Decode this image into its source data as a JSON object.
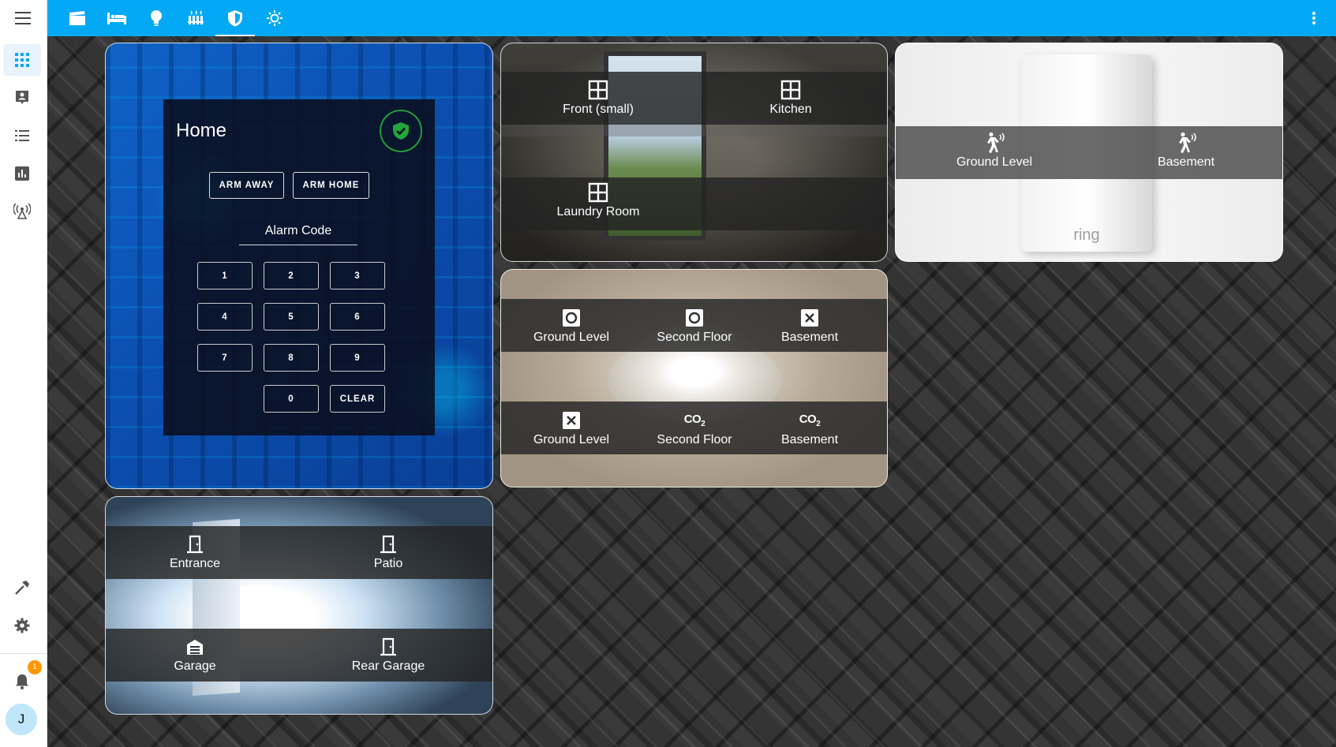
{
  "app": {
    "accent": "#03a9f4",
    "view_tabs": [
      {
        "icon": "movie-clapper-icon",
        "active": false
      },
      {
        "icon": "bed-icon",
        "active": false
      },
      {
        "icon": "lightbulb-icon",
        "active": false
      },
      {
        "icon": "radiator-icon",
        "active": false
      },
      {
        "icon": "shield-icon",
        "active": true
      },
      {
        "icon": "sun-icon",
        "active": false
      }
    ]
  },
  "sidebar": {
    "items": [
      {
        "icon": "grid-dashboard-icon",
        "active": true
      },
      {
        "icon": "account-box-icon",
        "active": false
      },
      {
        "icon": "list-icon",
        "active": false
      },
      {
        "icon": "chart-icon",
        "active": false
      },
      {
        "icon": "antenna-icon",
        "active": false
      }
    ],
    "bottom_items": [
      {
        "icon": "hammer-icon"
      },
      {
        "icon": "gear-icon"
      }
    ],
    "notification_count": "1",
    "user_initial": "J"
  },
  "alarm": {
    "state": "Home",
    "arm_away": "ARM AWAY",
    "arm_home": "ARM HOME",
    "code_label": "Alarm Code",
    "keys": [
      "1",
      "2",
      "3",
      "4",
      "5",
      "6",
      "7",
      "8",
      "9",
      "0",
      "CLEAR"
    ]
  },
  "windows": {
    "sensors": [
      {
        "label": "Front (small)",
        "icon": "window-icon"
      },
      {
        "label": "Kitchen",
        "icon": "window-icon"
      },
      {
        "label": "Laundry Room",
        "icon": "window-icon"
      }
    ]
  },
  "motion": {
    "brand": "ring",
    "sensors": [
      {
        "label": "Ground Level",
        "icon": "motion-walk-icon"
      },
      {
        "label": "Basement",
        "icon": "motion-walk-icon"
      }
    ]
  },
  "smoke": {
    "smoke_sensors": [
      {
        "label": "Ground Level",
        "icon": "smoke-ok-icon"
      },
      {
        "label": "Second Floor",
        "icon": "smoke-ok-icon"
      },
      {
        "label": "Basement",
        "icon": "smoke-alert-icon"
      }
    ],
    "co2_sensors": [
      {
        "label": "Ground Level",
        "icon": "co-alert-icon"
      },
      {
        "label": "Second Floor",
        "icon": "co2-icon",
        "text": "CO2"
      },
      {
        "label": "Basement",
        "icon": "co2-icon",
        "text": "CO2"
      }
    ]
  },
  "doors": {
    "sensors": [
      {
        "label": "Entrance",
        "icon": "door-icon"
      },
      {
        "label": "Patio",
        "icon": "door-icon"
      },
      {
        "label": "Garage",
        "icon": "garage-icon"
      },
      {
        "label": "Rear Garage",
        "icon": "door-icon"
      }
    ]
  }
}
